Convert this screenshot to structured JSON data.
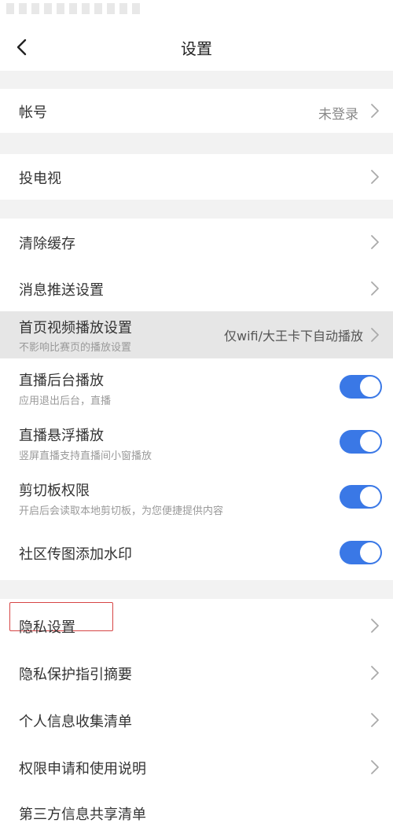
{
  "header": {
    "title": "设置"
  },
  "account": {
    "label": "帐号",
    "value": "未登录"
  },
  "cast": {
    "label": "投电视"
  },
  "clear_cache": {
    "label": "清除缓存"
  },
  "push": {
    "label": "消息推送设置"
  },
  "autoplay": {
    "label": "首页视频播放设置",
    "sub": "不影响比赛页的播放设置",
    "value": "仅wifi/大王卡下自动播放"
  },
  "bg_play": {
    "label": "直播后台播放",
    "sub": "应用退出后台，直播",
    "on": true
  },
  "float_play": {
    "label": "直播悬浮播放",
    "sub": "竖屏直播支持直播间小窗播放",
    "on": true
  },
  "clipboard": {
    "label": "剪切板权限",
    "sub": "开启后会读取本地剪切板，为您便捷提供内容",
    "on": true
  },
  "watermark": {
    "label": "社区传图添加水印",
    "on": true
  },
  "privacy": {
    "label": "隐私设置"
  },
  "privacy_guide": {
    "label": "隐私保护指引摘要"
  },
  "personal_info": {
    "label": "个人信息收集清单"
  },
  "permissions": {
    "label": "权限申请和使用说明"
  },
  "third_party": {
    "label": "第三方信息共享清单"
  },
  "colors": {
    "toggle_on": "#3a78e6",
    "highlight_box": "#d64545"
  }
}
